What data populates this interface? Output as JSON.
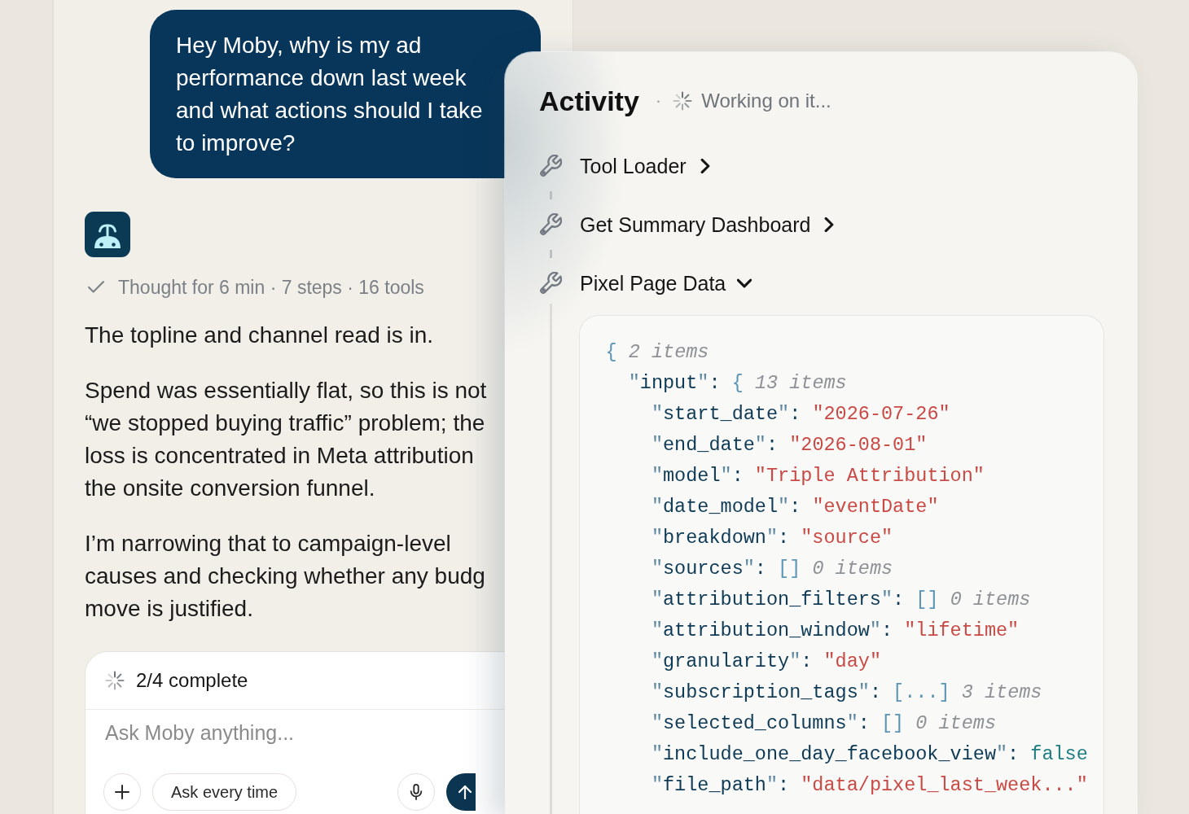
{
  "chat": {
    "user_message": "Hey Moby, why is my ad performance down last week and what actions should I take to improve?",
    "thought": {
      "done": true,
      "text": "Thought for 6 min · 7 steps · 16 tools"
    },
    "paragraphs": [
      {
        "lines": [
          "The topline and channel read is in."
        ]
      },
      {
        "lines": [
          "Spend was essentially flat, so this is not",
          "“we stopped buying traffic” problem; the",
          "loss is concentrated in Meta attribution",
          "the onsite conversion funnel."
        ]
      },
      {
        "lines": [
          "I’m narrowing that to campaign-level",
          "causes and checking whether any budg",
          "move is justified."
        ]
      }
    ]
  },
  "composer": {
    "progress": "2/4 complete",
    "placeholder": "Ask Moby anything...",
    "buttons": [
      {
        "kind": "add"
      },
      {
        "kind": "mode",
        "label": "Ask every time"
      },
      {
        "kind": "mic"
      },
      {
        "kind": "send"
      }
    ]
  },
  "activity": {
    "title": "Activity",
    "separator": "·",
    "status": "Working on it...",
    "tools": [
      {
        "name": "Tool Loader",
        "expanded": false
      },
      {
        "name": "Get Summary Dashboard",
        "expanded": false
      },
      {
        "name": "Pixel Page Data",
        "expanded": true,
        "output": {
          "value": {
            "kind": "brace",
            "text": "{"
          },
          "count": "2 items",
          "children": [
            {
              "key": "\"input\"",
              "colon": ":",
              "value": {
                "kind": "brace",
                "text": "{"
              },
              "count": "13 items",
              "children": [
                {
                  "key": "\"start_date\"",
                  "colon": ":",
                  "value": {
                    "kind": "string",
                    "text": "\"2026-07-26\""
                  }
                },
                {
                  "key": "\"end_date\"",
                  "colon": ":",
                  "value": {
                    "kind": "string",
                    "text": "\"2026-08-01\""
                  }
                },
                {
                  "key": "\"model\"",
                  "colon": ":",
                  "value": {
                    "kind": "string",
                    "text": "\"Triple Attribution\""
                  }
                },
                {
                  "key": "\"date_model\"",
                  "colon": ":",
                  "value": {
                    "kind": "string",
                    "text": "\"eventDate\""
                  }
                },
                {
                  "key": "\"breakdown\"",
                  "colon": ":",
                  "value": {
                    "kind": "string",
                    "text": "\"source\""
                  }
                },
                {
                  "key": "\"sources\"",
                  "colon": ":",
                  "value": {
                    "kind": "brace",
                    "text": "[]"
                  },
                  "count": "0 items"
                },
                {
                  "key": "\"attribution_filters\"",
                  "colon": ":",
                  "value": {
                    "kind": "brace",
                    "text": "[]"
                  },
                  "count": "0 items"
                },
                {
                  "key": "\"attribution_window\"",
                  "colon": ":",
                  "value": {
                    "kind": "string",
                    "text": "\"lifetime\""
                  }
                },
                {
                  "key": "\"granularity\"",
                  "colon": ":",
                  "value": {
                    "kind": "string",
                    "text": "\"day\""
                  }
                },
                {
                  "key": "\"subscription_tags\"",
                  "colon": ":",
                  "value": {
                    "kind": "brace",
                    "text": "[...]"
                  },
                  "count": "3 items"
                },
                {
                  "key": "\"selected_columns\"",
                  "colon": ":",
                  "value": {
                    "kind": "brace",
                    "text": "[]"
                  },
                  "count": "0 items"
                },
                {
                  "key": "\"include_one_day_facebook_view\"",
                  "colon": ":",
                  "value": {
                    "kind": "bool",
                    "text": "false"
                  }
                },
                {
                  "key": "\"file_path\"",
                  "colon": ":",
                  "value": {
                    "kind": "string",
                    "text": "\"data/pixel_last_week...\""
                  }
                }
              ]
            }
          ]
        }
      }
    ]
  }
}
